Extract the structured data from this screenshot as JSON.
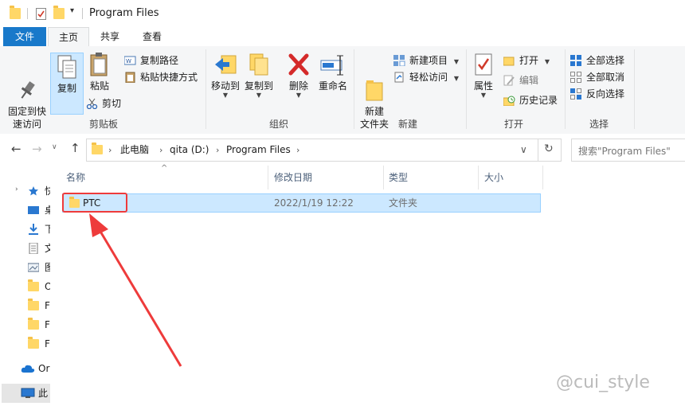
{
  "window": {
    "title": "Program Files"
  },
  "tabs": [
    {
      "label": "文件"
    },
    {
      "label": "主页"
    },
    {
      "label": "共享"
    },
    {
      "label": "查看"
    }
  ],
  "ribbon": {
    "clipboard": {
      "pin_label": "固定到快\n速访问",
      "copy_label": "复制",
      "paste_label": "粘贴",
      "copy_path": "复制路径",
      "paste_shortcut": "粘贴快捷方式",
      "cut": "剪切",
      "group": "剪贴板"
    },
    "organize": {
      "move_to": "移动到",
      "copy_to": "复制到",
      "delete": "删除",
      "rename": "重命名",
      "group": "组织"
    },
    "new": {
      "new_folder": "新建\n文件夹",
      "new_item": "新建项目",
      "easy_access": "轻松访问",
      "group": "新建"
    },
    "open": {
      "properties": "属性",
      "open": "打开",
      "edit": "编辑",
      "history": "历史记录",
      "group": "打开"
    },
    "select": {
      "select_all": "全部选择",
      "select_none": "全部取消",
      "invert": "反向选择",
      "group": "选择"
    }
  },
  "address": {
    "crumbs": [
      "此电脑",
      "qita (D:)",
      "Program Files"
    ]
  },
  "search": {
    "placeholder": "搜索\"Program Files\""
  },
  "nav": {
    "items": [
      {
        "label": "快",
        "icon": "star-icon"
      },
      {
        "label": "桌",
        "icon": "desktop-icon"
      },
      {
        "label": "下",
        "icon": "download-icon"
      },
      {
        "label": "文",
        "icon": "document-icon"
      },
      {
        "label": "图",
        "icon": "picture-icon"
      },
      {
        "label": "O",
        "icon": "folder-icon"
      },
      {
        "label": "F",
        "icon": "folder-icon"
      },
      {
        "label": "F",
        "icon": "folder-icon"
      },
      {
        "label": "F",
        "icon": "folder-icon"
      },
      {
        "label": "Or",
        "icon": "cloud-icon"
      },
      {
        "label": "此",
        "icon": "computer-icon"
      }
    ]
  },
  "columns": {
    "name": "名称",
    "modified": "修改日期",
    "type": "类型",
    "size": "大小"
  },
  "rows": [
    {
      "name": "PTC",
      "modified": "2022/1/19 12:22",
      "type": "文件夹",
      "size": ""
    }
  ],
  "watermark": "@cui_style",
  "colors": {
    "accent": "#1979ca",
    "selection": "#cce8ff",
    "highlight": "#ee3b3b",
    "folder": "#ffd767"
  }
}
